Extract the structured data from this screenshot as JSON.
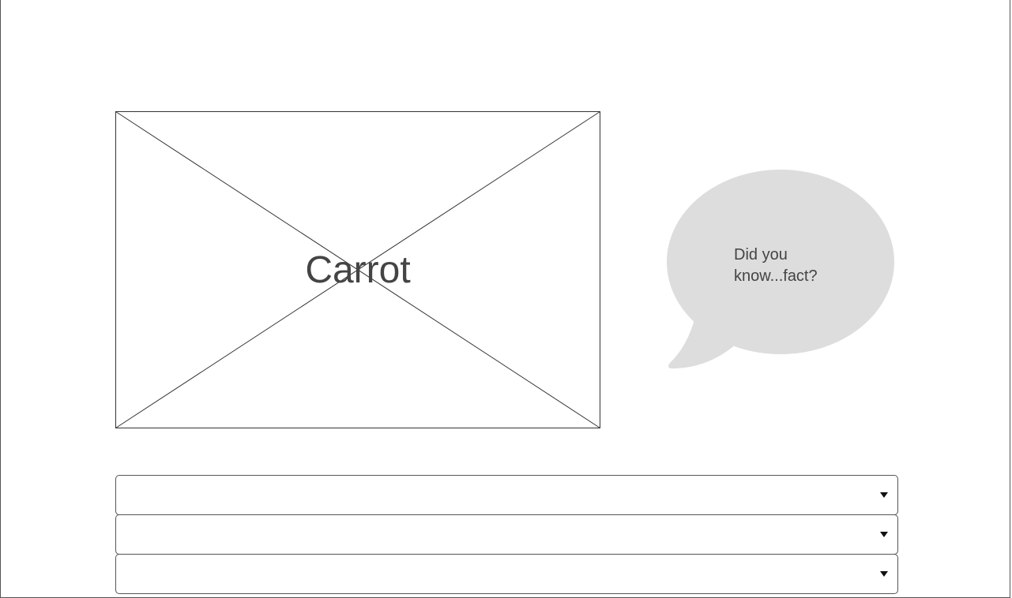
{
  "image_placeholder": {
    "label": "Carrot"
  },
  "fact_bubble": {
    "text": "Did you know...fact?",
    "fill_color": "#dddddd"
  },
  "dropdowns": [
    {
      "selected": ""
    },
    {
      "selected": ""
    },
    {
      "selected": ""
    }
  ],
  "icons": {
    "dropdown_arrow": "chevron-down-icon"
  }
}
